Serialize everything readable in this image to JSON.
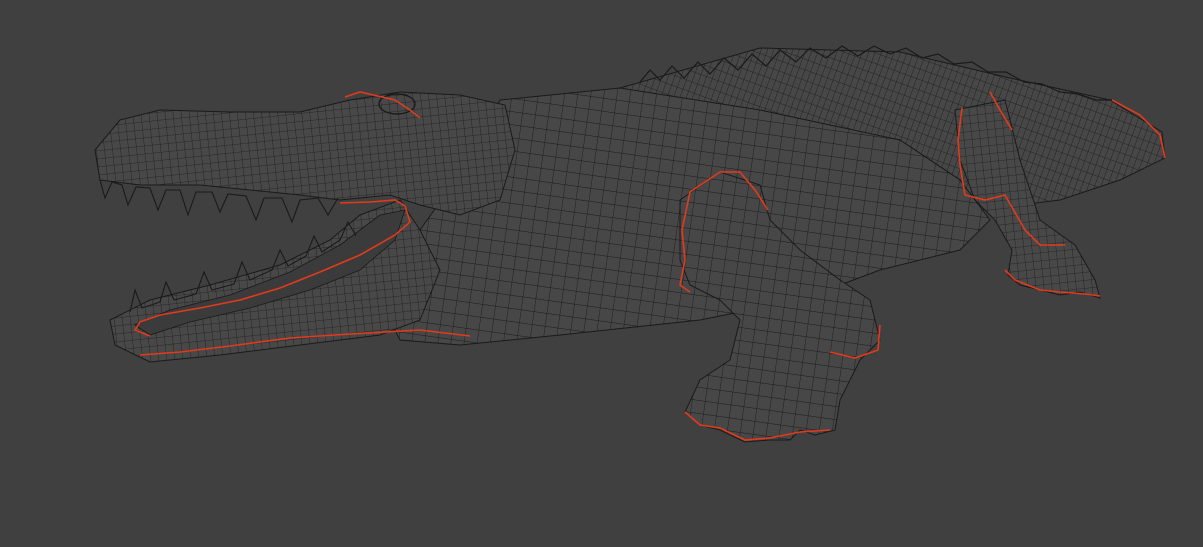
{
  "viewport": {
    "background_color": "#404040",
    "render_mode": "wireframe",
    "subject": "crocodile",
    "wire_color": "#1a1a1a",
    "seam_color": "#e23a1c",
    "mesh_fill_color": "#474747"
  }
}
